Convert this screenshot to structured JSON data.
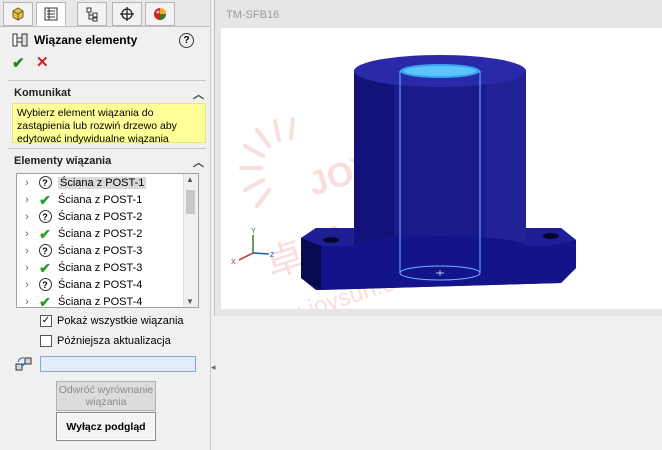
{
  "tabs": [
    {
      "name": "feature-manager",
      "icon": "feature-tree-icon"
    },
    {
      "name": "property-manager",
      "icon": "property-manager-icon"
    },
    {
      "name": "configuration-manager",
      "icon": "configuration-icon"
    },
    {
      "name": "dimxpert-manager",
      "icon": "dimxpert-crosshair-icon"
    },
    {
      "name": "display-manager",
      "icon": "appearance-sphere-icon"
    }
  ],
  "panel": {
    "title": "Wiązane elementy",
    "help_icon": "help-icon",
    "ok_icon": "check-icon",
    "cancel_icon": "close-icon"
  },
  "message": {
    "header": "Komunikat",
    "text": "Wybierz element wiązania do zastąpienia lub rozwiń drzewo aby edytować indywidualne wiązania"
  },
  "mate_entities": {
    "header": "Elementy wiązania",
    "items": [
      {
        "label": "Ściana z POST-1",
        "status": "unknown",
        "selected": true
      },
      {
        "label": "Ściana z POST-1",
        "status": "ok"
      },
      {
        "label": "Ściana z POST-2",
        "status": "unknown"
      },
      {
        "label": "Ściana z POST-2",
        "status": "ok"
      },
      {
        "label": "Ściana z POST-3",
        "status": "unknown"
      },
      {
        "label": "Ściana z POST-3",
        "status": "ok"
      },
      {
        "label": "Ściana z POST-4",
        "status": "unknown"
      },
      {
        "label": "Ściana z POST-4",
        "status": "ok"
      }
    ]
  },
  "options": {
    "show_all_mates": {
      "label": "Pokaż wszystkie wiązania",
      "checked": true
    },
    "later_update": {
      "label": "Późniejsza aktualizacja",
      "checked": false
    }
  },
  "replacement_input": {
    "value": ""
  },
  "buttons": {
    "flip_alignment": {
      "line1": "Odwróć wyrównanie",
      "line2": "wiązania",
      "enabled": false
    },
    "disable_preview": {
      "label": "Wyłącz podgląd",
      "enabled": true
    }
  },
  "viewport": {
    "title": "TM-SFB16",
    "model_color": "#1a1a8c",
    "background": "#ffffff"
  },
  "watermark": {
    "text": "JOYSUN",
    "chinese": "卓 盈",
    "url": "sw-joysun.c"
  }
}
